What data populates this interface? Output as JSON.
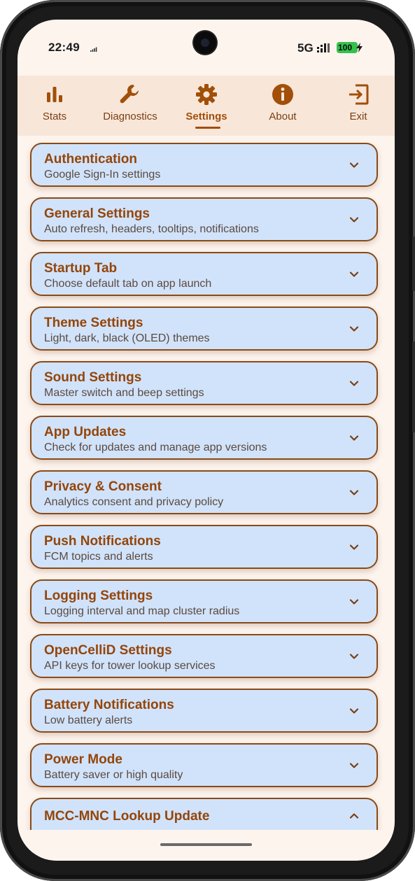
{
  "status_bar": {
    "time": "22:49",
    "network": "5G",
    "battery_level": "100",
    "battery_color": "#33c24d"
  },
  "tabs": [
    {
      "label": "Stats",
      "icon": "bar-chart-icon"
    },
    {
      "label": "Diagnostics",
      "icon": "wrench-icon"
    },
    {
      "label": "Settings",
      "icon": "gear-icon",
      "active": true
    },
    {
      "label": "About",
      "icon": "info-icon"
    },
    {
      "label": "Exit",
      "icon": "exit-icon"
    }
  ],
  "sections": [
    {
      "title": "Authentication",
      "subtitle": "Google Sign-In settings",
      "expanded": false
    },
    {
      "title": "General Settings",
      "subtitle": "Auto refresh, headers, tooltips, notifications",
      "expanded": false
    },
    {
      "title": "Startup Tab",
      "subtitle": "Choose default tab on app launch",
      "expanded": false
    },
    {
      "title": "Theme Settings",
      "subtitle": "Light, dark, black (OLED) themes",
      "expanded": false
    },
    {
      "title": "Sound Settings",
      "subtitle": "Master switch and beep settings",
      "expanded": false
    },
    {
      "title": "App Updates",
      "subtitle": "Check for updates and manage app versions",
      "expanded": false
    },
    {
      "title": "Privacy & Consent",
      "subtitle": "Analytics consent and privacy policy",
      "expanded": false
    },
    {
      "title": "Push Notifications",
      "subtitle": "FCM topics and alerts",
      "expanded": false
    },
    {
      "title": "Logging Settings",
      "subtitle": "Logging interval and map cluster radius",
      "expanded": false
    },
    {
      "title": "OpenCelliD Settings",
      "subtitle": "API keys for tower lookup services",
      "expanded": false
    },
    {
      "title": "Battery Notifications",
      "subtitle": "Low battery alerts",
      "expanded": false
    },
    {
      "title": "Power Mode",
      "subtitle": "Battery saver or high quality",
      "expanded": false
    },
    {
      "title": "MCC-MNC Lookup Update",
      "subtitle": "",
      "expanded": true
    }
  ],
  "colors": {
    "accent": "#a14f09",
    "card_bg": "#d1e3fb",
    "card_border": "#8a4a16",
    "tab_bar_bg": "#f8e6d9",
    "screen_bg": "#fdf4ee"
  }
}
